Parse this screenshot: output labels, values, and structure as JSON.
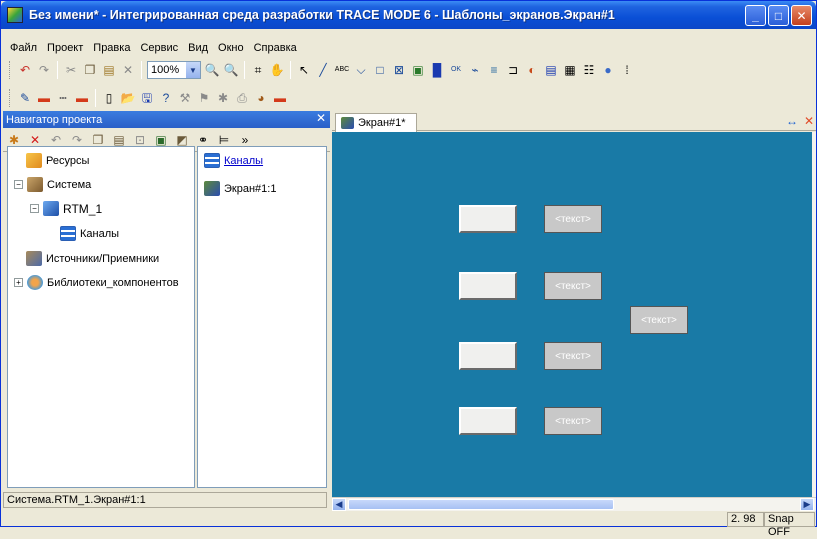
{
  "window": {
    "title": "Без имени* - Интегрированная среда разработки TRACE MODE 6 - Шаблоны_экранов.Экран#1",
    "controls": [
      "_",
      "□",
      "✕"
    ]
  },
  "menu": [
    "Файл",
    "Проект",
    "Правка",
    "Сервис",
    "Вид",
    "Окно",
    "Справка"
  ],
  "toolbar": {
    "zoom": "100%"
  },
  "navigator": {
    "title": "Навигатор проекта",
    "close": "✕",
    "more": "»",
    "tree": {
      "resources": "Ресурсы",
      "system": "Система",
      "rtm": "RTM_1",
      "channels": "Каналы",
      "sources": "Источники/Приемники",
      "libraries": "Библиотеки_компонентов"
    },
    "list": {
      "channels": "Каналы",
      "screen": "Экран#1:1"
    },
    "path": "Система.RTM_1.Экран#1:1"
  },
  "editor": {
    "tab": "Экран#1*",
    "labels": [
      "<текст>",
      "<текст>",
      "<текст>",
      "<текст>",
      "<текст>"
    ]
  },
  "status": {
    "value": "2. 98",
    "snap": "Snap OFF"
  }
}
